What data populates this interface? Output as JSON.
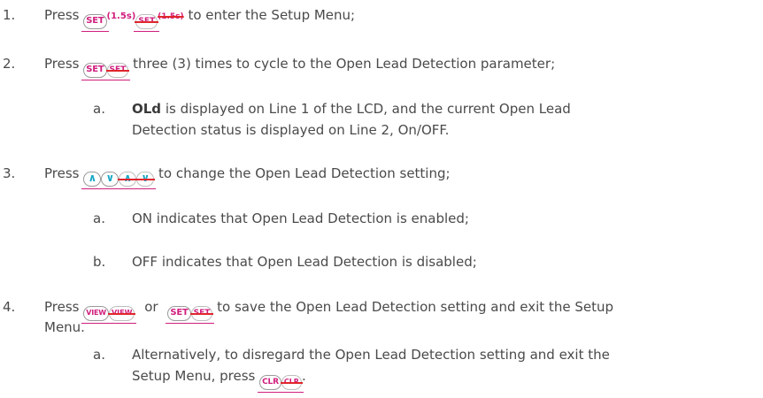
{
  "steps": [
    {
      "number": "1.",
      "press": "Press",
      "key_set": "SET",
      "set_duration": "(1.5s)",
      "set_duration_struck": "(1.5s)",
      "text": "to enter the Setup Menu;"
    },
    {
      "number": "2.",
      "press": "Press",
      "key_set": "SET",
      "text": "three (3) times to cycle to the Open Lead Detection parameter;",
      "sub": [
        {
          "letter": "a.",
          "code": "OLd",
          "text_line1": "is displayed on Line 1 of the LCD, and the current Open Lead",
          "text_line2": "Detection status is displayed on Line 2, On/OFF."
        }
      ]
    },
    {
      "number": "3.",
      "press": "Press",
      "key_up_icon": "chevron-up-icon",
      "key_down_icon": "chevron-down-icon",
      "text": "to change the Open Lead Detection setting;",
      "sub": [
        {
          "letter": "a.",
          "text": "ON indicates that Open Lead Detection is enabled;"
        },
        {
          "letter": "b.",
          "text": "OFF indicates that Open Lead Detection is disabled;"
        }
      ]
    },
    {
      "number": "4.",
      "press": "Press",
      "key_view": "VIEW",
      "or": "or",
      "key_set": "SET",
      "text_line1": "to save the Open Lead Detection setting and exit the Setup",
      "text_line2": "Menu.",
      "sub": [
        {
          "letter": "a.",
          "text_line1": "Alternatively, to disregard the Open Lead Detection setting and exit the",
          "text_line2": "Setup Menu, press",
          "key_clr": "CLR",
          "end": "."
        }
      ]
    }
  ],
  "colors": {
    "text": "#4a4a4a",
    "key_label": "#d01e7d",
    "arrow": "#1aa7c9",
    "strike": "#e0262c"
  }
}
